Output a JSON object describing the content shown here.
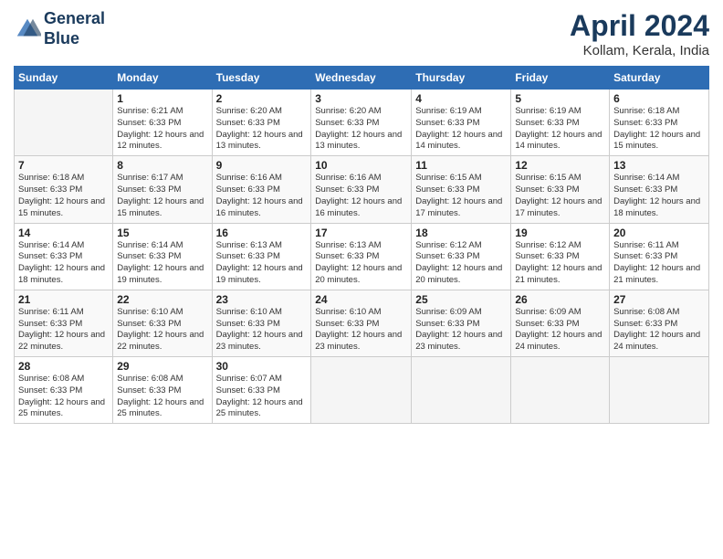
{
  "header": {
    "logo_line1": "General",
    "logo_line2": "Blue",
    "month_year": "April 2024",
    "location": "Kollam, Kerala, India"
  },
  "weekdays": [
    "Sunday",
    "Monday",
    "Tuesday",
    "Wednesday",
    "Thursday",
    "Friday",
    "Saturday"
  ],
  "weeks": [
    [
      {
        "day": "",
        "info": ""
      },
      {
        "day": "1",
        "info": "Sunrise: 6:21 AM\nSunset: 6:33 PM\nDaylight: 12 hours\nand 12 minutes."
      },
      {
        "day": "2",
        "info": "Sunrise: 6:20 AM\nSunset: 6:33 PM\nDaylight: 12 hours\nand 13 minutes."
      },
      {
        "day": "3",
        "info": "Sunrise: 6:20 AM\nSunset: 6:33 PM\nDaylight: 12 hours\nand 13 minutes."
      },
      {
        "day": "4",
        "info": "Sunrise: 6:19 AM\nSunset: 6:33 PM\nDaylight: 12 hours\nand 14 minutes."
      },
      {
        "day": "5",
        "info": "Sunrise: 6:19 AM\nSunset: 6:33 PM\nDaylight: 12 hours\nand 14 minutes."
      },
      {
        "day": "6",
        "info": "Sunrise: 6:18 AM\nSunset: 6:33 PM\nDaylight: 12 hours\nand 15 minutes."
      }
    ],
    [
      {
        "day": "7",
        "info": "Sunrise: 6:18 AM\nSunset: 6:33 PM\nDaylight: 12 hours\nand 15 minutes."
      },
      {
        "day": "8",
        "info": "Sunrise: 6:17 AM\nSunset: 6:33 PM\nDaylight: 12 hours\nand 15 minutes."
      },
      {
        "day": "9",
        "info": "Sunrise: 6:16 AM\nSunset: 6:33 PM\nDaylight: 12 hours\nand 16 minutes."
      },
      {
        "day": "10",
        "info": "Sunrise: 6:16 AM\nSunset: 6:33 PM\nDaylight: 12 hours\nand 16 minutes."
      },
      {
        "day": "11",
        "info": "Sunrise: 6:15 AM\nSunset: 6:33 PM\nDaylight: 12 hours\nand 17 minutes."
      },
      {
        "day": "12",
        "info": "Sunrise: 6:15 AM\nSunset: 6:33 PM\nDaylight: 12 hours\nand 17 minutes."
      },
      {
        "day": "13",
        "info": "Sunrise: 6:14 AM\nSunset: 6:33 PM\nDaylight: 12 hours\nand 18 minutes."
      }
    ],
    [
      {
        "day": "14",
        "info": "Sunrise: 6:14 AM\nSunset: 6:33 PM\nDaylight: 12 hours\nand 18 minutes."
      },
      {
        "day": "15",
        "info": "Sunrise: 6:14 AM\nSunset: 6:33 PM\nDaylight: 12 hours\nand 19 minutes."
      },
      {
        "day": "16",
        "info": "Sunrise: 6:13 AM\nSunset: 6:33 PM\nDaylight: 12 hours\nand 19 minutes."
      },
      {
        "day": "17",
        "info": "Sunrise: 6:13 AM\nSunset: 6:33 PM\nDaylight: 12 hours\nand 20 minutes."
      },
      {
        "day": "18",
        "info": "Sunrise: 6:12 AM\nSunset: 6:33 PM\nDaylight: 12 hours\nand 20 minutes."
      },
      {
        "day": "19",
        "info": "Sunrise: 6:12 AM\nSunset: 6:33 PM\nDaylight: 12 hours\nand 21 minutes."
      },
      {
        "day": "20",
        "info": "Sunrise: 6:11 AM\nSunset: 6:33 PM\nDaylight: 12 hours\nand 21 minutes."
      }
    ],
    [
      {
        "day": "21",
        "info": "Sunrise: 6:11 AM\nSunset: 6:33 PM\nDaylight: 12 hours\nand 22 minutes."
      },
      {
        "day": "22",
        "info": "Sunrise: 6:10 AM\nSunset: 6:33 PM\nDaylight: 12 hours\nand 22 minutes."
      },
      {
        "day": "23",
        "info": "Sunrise: 6:10 AM\nSunset: 6:33 PM\nDaylight: 12 hours\nand 23 minutes."
      },
      {
        "day": "24",
        "info": "Sunrise: 6:10 AM\nSunset: 6:33 PM\nDaylight: 12 hours\nand 23 minutes."
      },
      {
        "day": "25",
        "info": "Sunrise: 6:09 AM\nSunset: 6:33 PM\nDaylight: 12 hours\nand 23 minutes."
      },
      {
        "day": "26",
        "info": "Sunrise: 6:09 AM\nSunset: 6:33 PM\nDaylight: 12 hours\nand 24 minutes."
      },
      {
        "day": "27",
        "info": "Sunrise: 6:08 AM\nSunset: 6:33 PM\nDaylight: 12 hours\nand 24 minutes."
      }
    ],
    [
      {
        "day": "28",
        "info": "Sunrise: 6:08 AM\nSunset: 6:33 PM\nDaylight: 12 hours\nand 25 minutes."
      },
      {
        "day": "29",
        "info": "Sunrise: 6:08 AM\nSunset: 6:33 PM\nDaylight: 12 hours\nand 25 minutes."
      },
      {
        "day": "30",
        "info": "Sunrise: 6:07 AM\nSunset: 6:33 PM\nDaylight: 12 hours\nand 25 minutes."
      },
      {
        "day": "",
        "info": ""
      },
      {
        "day": "",
        "info": ""
      },
      {
        "day": "",
        "info": ""
      },
      {
        "day": "",
        "info": ""
      }
    ]
  ]
}
